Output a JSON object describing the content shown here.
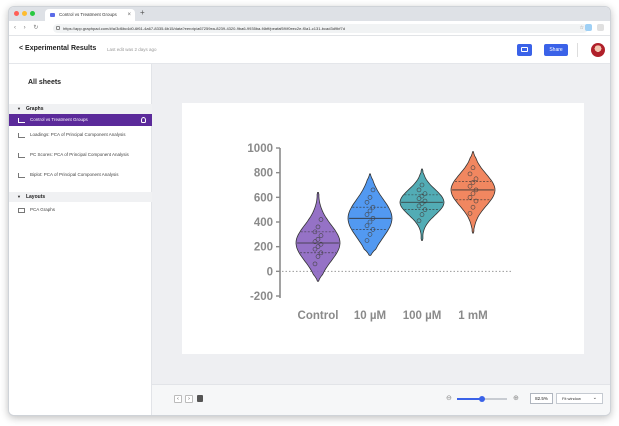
{
  "browser": {
    "tab_title": "Control vs Treatment Groups",
    "tab_close": "×",
    "new_tab": "+",
    "nav_buttons": "‹ › ↻",
    "url": "https://app.graphpad.com/#/a/3d6bc4d0-6f61-4a67-8335-6b15/data?eerotp/a67259ea-8239-4320-9ba6-9935ba-f4bff/peafaf59/f0eec2e-f0a1-c131-bcad3d9bf7d",
    "star": "☆",
    "colors": {
      "red": "#ff5f57",
      "yellow": "#febc2e",
      "green": "#28c840"
    }
  },
  "header": {
    "back_label": "< Experimental Results",
    "last_edit": "Last edit was 2 days ago",
    "share_label": "Share"
  },
  "sidebar": {
    "title": "All sheets",
    "sections": [
      {
        "label": "Graphs"
      },
      {
        "label": "Layouts"
      }
    ],
    "items": [
      {
        "label": "Control vs Treatment Groups",
        "selected": true
      },
      {
        "label": "Loadings: PCA of Principal Component Analysis"
      },
      {
        "label": "PC Scores: PCA of Principal Component Analysis"
      },
      {
        "label": "Biplot: PCA of Principal Component Analysis"
      },
      {
        "label": "PCA Graphs"
      }
    ],
    "accent": "#5b2a9a"
  },
  "chart_data": {
    "type": "violin",
    "categories": [
      "Control",
      "10 µM",
      "100 µM",
      "1 mM"
    ],
    "yticks": [
      1000,
      800,
      600,
      400,
      200,
      0,
      -200
    ],
    "ylim": [
      -200,
      1000
    ],
    "grid": false,
    "series": [
      {
        "min": -80,
        "max": 640,
        "median": 230,
        "q1": 150,
        "q3": 320,
        "color": "#8a63c0",
        "points": [
          60,
          120,
          150,
          180,
          200,
          220,
          240,
          260,
          290,
          320,
          360,
          420
        ]
      },
      {
        "min": 130,
        "max": 790,
        "median": 430,
        "q1": 340,
        "q3": 520,
        "color": "#3f8ef0",
        "points": [
          250,
          300,
          340,
          370,
          400,
          430,
          460,
          490,
          520,
          560,
          600,
          660
        ]
      },
      {
        "min": 250,
        "max": 830,
        "median": 560,
        "q1": 500,
        "q3": 620,
        "color": "#3fa3ad",
        "points": [
          410,
          460,
          500,
          530,
          550,
          570,
          590,
          610,
          630,
          660,
          700
        ]
      },
      {
        "min": 310,
        "max": 970,
        "median": 660,
        "q1": 580,
        "q3": 730,
        "color": "#f07a4f",
        "points": [
          470,
          520,
          570,
          600,
          630,
          660,
          690,
          720,
          750,
          790,
          840
        ]
      }
    ]
  },
  "bottombar": {
    "prev": "‹",
    "next": "›",
    "zoom_out": "⊖",
    "zoom_in": "⊕",
    "zoom_fraction": 0.5,
    "zoom_value": "82.5%",
    "fit_label": "Fit window",
    "fit_chevron": "⌄"
  }
}
